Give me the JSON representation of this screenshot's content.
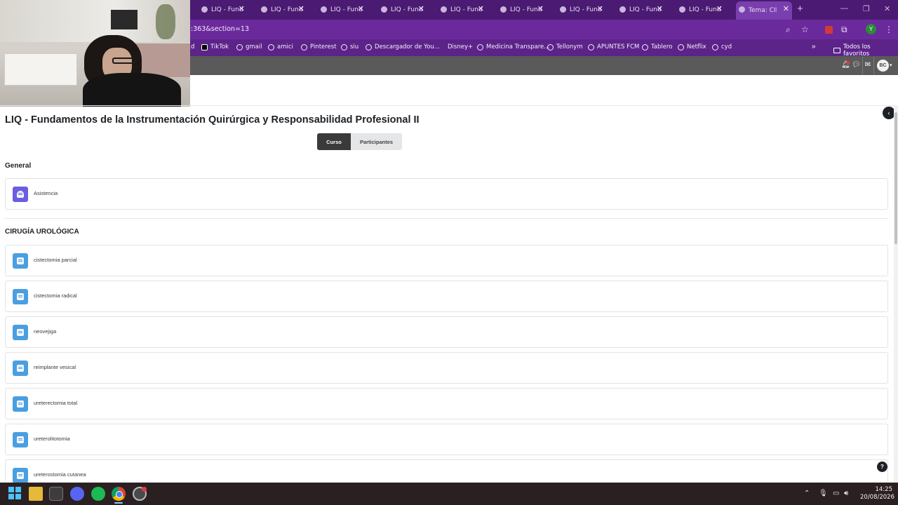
{
  "browser": {
    "tabs": [
      {
        "title": "LIQ - Fund"
      },
      {
        "title": "LIQ - Fund"
      },
      {
        "title": "LIQ - Fund"
      },
      {
        "title": "LIQ - Fund"
      },
      {
        "title": "LIQ - Fund"
      },
      {
        "title": "LIQ - Fund"
      },
      {
        "title": "LIQ - Fund"
      },
      {
        "title": "LIQ - Fund"
      },
      {
        "title": "LIQ - Fund"
      },
      {
        "title": "Tema: CIR"
      }
    ],
    "new_tab_icon": "+",
    "url_visible": ":363&section=13",
    "profile_letter": "Y",
    "bookmarks": [
      {
        "label": "d",
        "icon": "none"
      },
      {
        "label": "TikTok",
        "icon": "tiktok-icon"
      },
      {
        "label": "gmail",
        "icon": "globe-icon"
      },
      {
        "label": "amici",
        "icon": "globe-icon"
      },
      {
        "label": "Pinterest",
        "icon": "globe-icon"
      },
      {
        "label": "siu",
        "icon": "globe-icon"
      },
      {
        "label": "Descargador de You...",
        "icon": "globe-icon"
      },
      {
        "label": "Disney+",
        "icon": "none"
      },
      {
        "label": "Medicina Transpare...",
        "icon": "globe-icon"
      },
      {
        "label": "Tellonym",
        "icon": "globe-icon"
      },
      {
        "label": "APUNTES FCM",
        "icon": "globe-icon"
      },
      {
        "label": "Tablero",
        "icon": "globe-icon"
      },
      {
        "label": "Netflix",
        "icon": "globe-icon"
      },
      {
        "label": "cyd",
        "icon": "globe-icon"
      }
    ],
    "bookmarks_folder": "Todos los favoritos"
  },
  "navbar": {
    "user_initials": "BC"
  },
  "course": {
    "title": "LIQ - Fundamentos de la Instrumentación Quirúrgica y Responsabilidad Profesional II",
    "tabs": [
      {
        "label": "Curso",
        "active": true
      },
      {
        "label": "Participantes",
        "active": false
      }
    ],
    "sections": [
      {
        "name": "General",
        "activities": [
          {
            "label": "Asistencia",
            "icon": "attendance-icon"
          }
        ]
      },
      {
        "name": "CIRUGÍA UROLÓGICA",
        "activities": [
          {
            "label": "cistectomia parcial",
            "icon": "page-icon"
          },
          {
            "label": "cistectomia radical",
            "icon": "page-icon"
          },
          {
            "label": "neovejiga",
            "icon": "page-icon"
          },
          {
            "label": "reimplante vesical",
            "icon": "page-icon"
          },
          {
            "label": "ureterectomia total",
            "icon": "page-icon"
          },
          {
            "label": "ureterolitotomia",
            "icon": "page-icon"
          },
          {
            "label": "ureterostomia cutanea",
            "icon": "page-icon"
          }
        ]
      }
    ],
    "help_label": "?"
  },
  "taskbar": {
    "time": "14:25",
    "date": "20/08/2026"
  },
  "colors": {
    "browser_frame": "#4b1a72",
    "navbar": "#5a5a5a",
    "active_tab": "#3a3a3a",
    "page_icon": "#4a9fe0",
    "attendance_icon": "#6a5ee0"
  }
}
